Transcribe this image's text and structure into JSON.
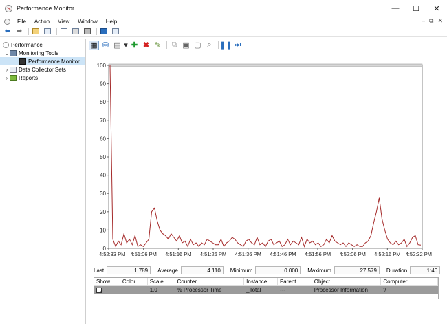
{
  "window": {
    "title": "Performance Monitor",
    "controls": [
      "—",
      "☐",
      "✕"
    ]
  },
  "menu": {
    "items": [
      "File",
      "Action",
      "View",
      "Window",
      "Help"
    ],
    "right_controls": [
      "–",
      "⧉",
      "✕"
    ]
  },
  "tree": {
    "root": "Performance",
    "monitoring_tools": "Monitoring Tools",
    "performance_monitor": "Performance Monitor",
    "data_collector_sets": "Data Collector Sets",
    "reports": "Reports"
  },
  "stats": {
    "last_label": "Last",
    "last": "1.789",
    "average_label": "Average",
    "average": "4.110",
    "minimum_label": "Minimum",
    "minimum": "0.000",
    "maximum_label": "Maximum",
    "maximum": "27.579",
    "duration_label": "Duration",
    "duration": "1:40"
  },
  "legend": {
    "headers": [
      "Show",
      "Color",
      "Scale",
      "Counter",
      "Instance",
      "Parent",
      "Object",
      "Computer"
    ],
    "row": {
      "checked": "✓",
      "scale": "1.0",
      "counter": "% Processor Time",
      "instance": "_Total",
      "parent": "---",
      "object": "Processor Information",
      "computer": "\\\\"
    }
  },
  "colors": {
    "series": "#a52a2a",
    "selection": "#cce4f7"
  },
  "chart_data": {
    "type": "line",
    "ylim": [
      0,
      100
    ],
    "y_ticks": [
      "100",
      "90",
      "80",
      "70",
      "60",
      "50",
      "40",
      "30",
      "20",
      "10",
      "0"
    ],
    "x_ticks": [
      "4:52:33 PM",
      "4:51:06 PM",
      "4:51:16 PM",
      "4:51:26 PM",
      "4:51:36 PM",
      "4:51:46 PM",
      "4:51:56 PM",
      "4:52:06 PM",
      "4:52:16 PM",
      "4:52:32 PM"
    ],
    "series": [
      {
        "values": [
          100,
          5,
          1,
          4,
          2,
          8,
          3,
          5,
          2,
          7,
          1,
          2,
          1,
          3,
          5,
          20,
          22,
          15,
          10,
          8,
          7,
          5,
          8,
          6,
          4,
          7,
          3,
          4,
          1,
          5,
          2,
          3,
          1,
          3,
          2,
          5,
          4,
          3,
          2,
          2,
          5,
          1,
          3,
          4,
          6,
          5,
          3,
          2,
          1,
          4,
          5,
          3,
          2,
          6,
          2,
          3,
          1,
          4,
          5,
          2,
          3,
          4,
          1,
          2,
          5,
          2,
          4,
          3,
          2,
          6,
          1,
          5,
          3,
          4,
          2,
          3,
          1,
          2,
          5,
          3,
          7,
          4,
          3,
          2,
          3,
          1,
          3,
          2,
          1,
          2,
          1,
          1,
          3,
          4,
          7,
          14,
          20,
          27.6,
          16,
          10,
          5,
          3,
          2,
          4,
          2,
          3,
          5,
          1,
          3,
          6,
          7,
          2,
          1.8
        ]
      }
    ]
  }
}
